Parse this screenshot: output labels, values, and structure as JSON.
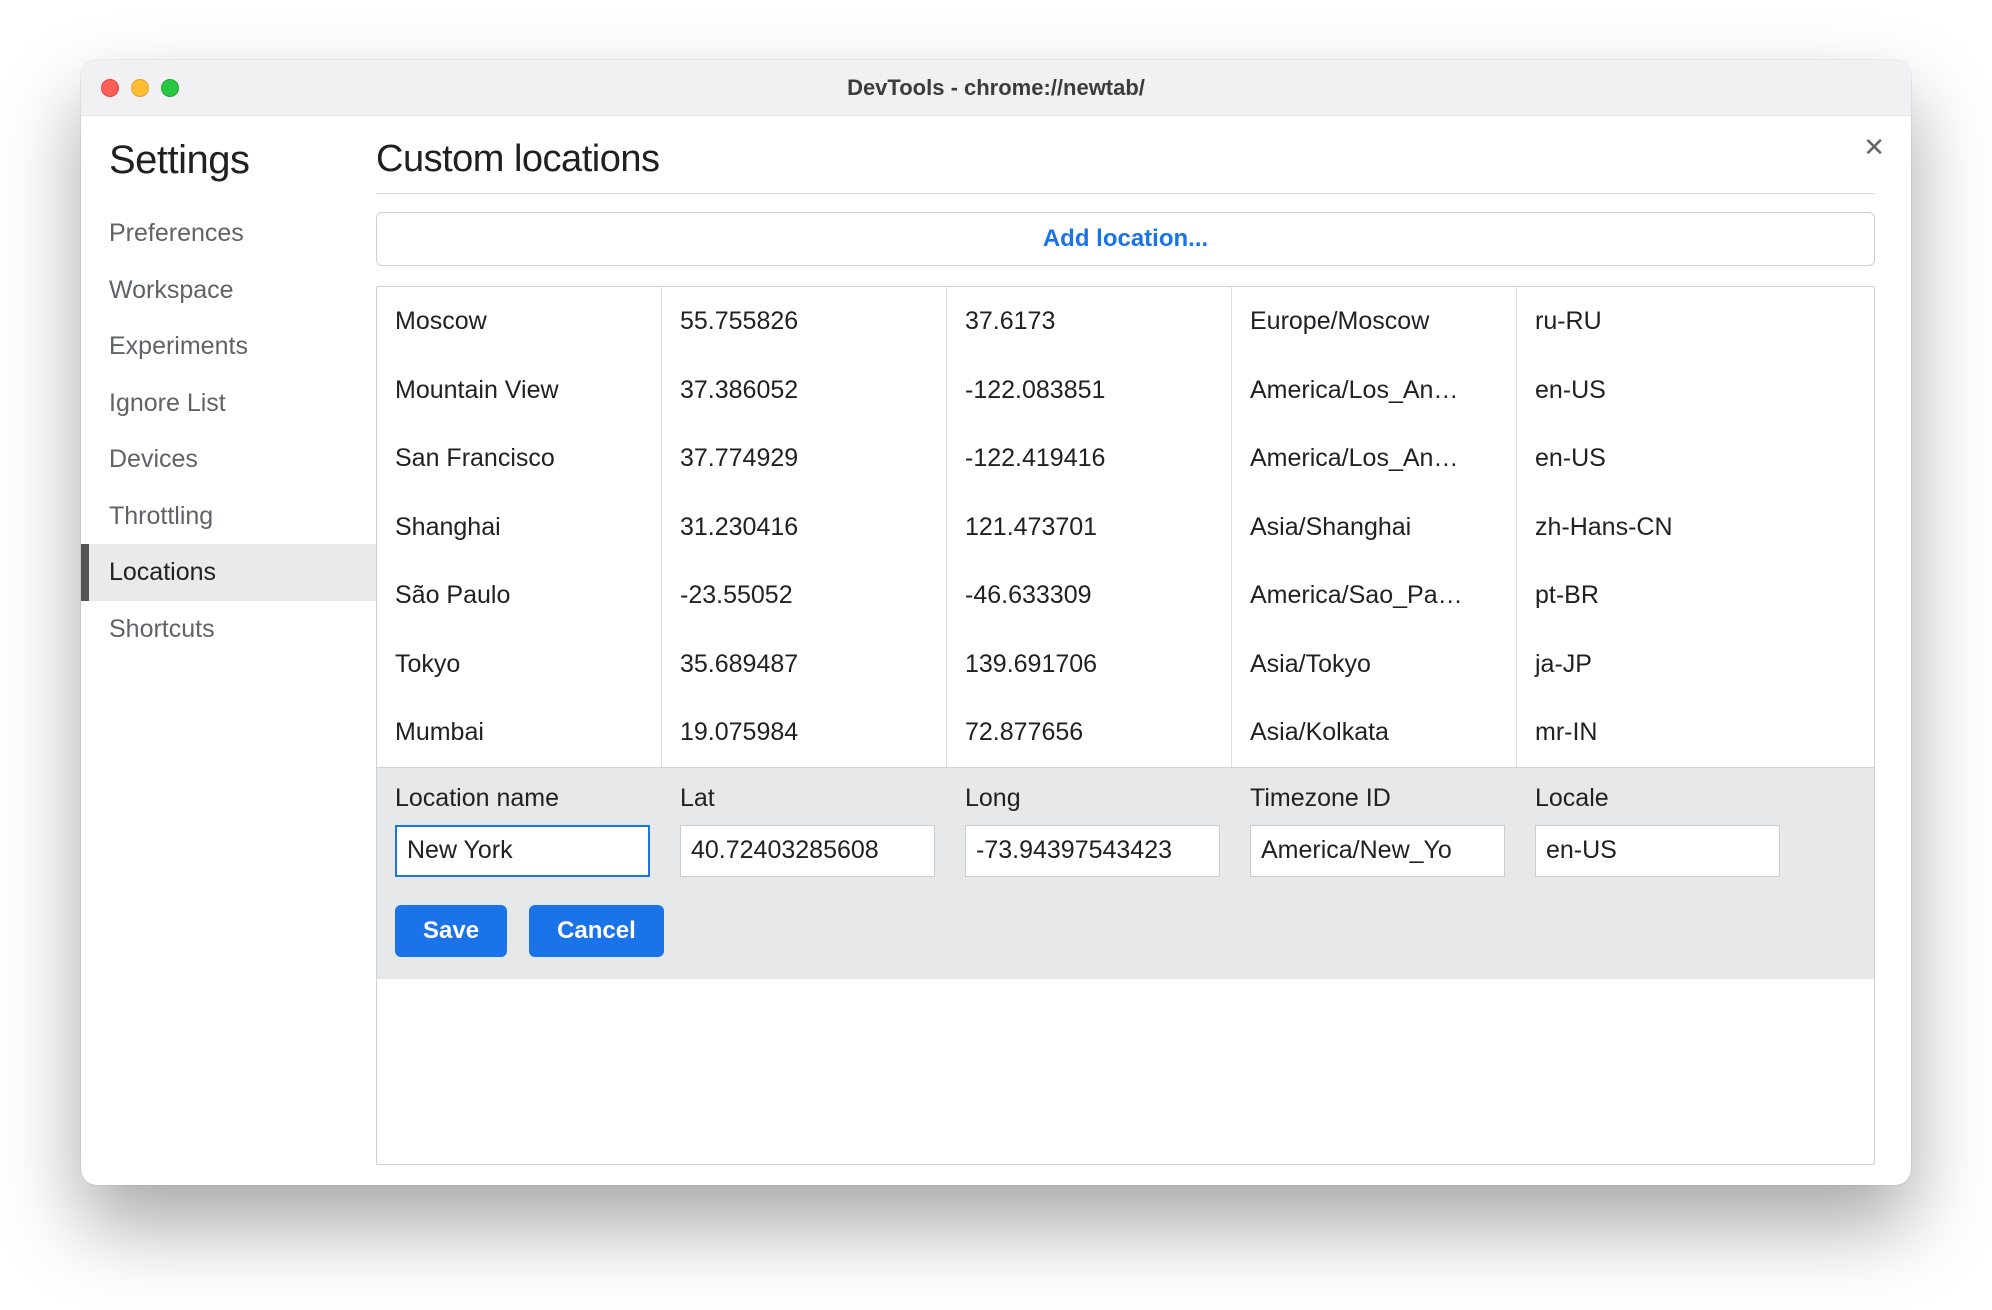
{
  "window": {
    "title": "DevTools - chrome://newtab/"
  },
  "close_glyph": "✕",
  "sidebar": {
    "title": "Settings",
    "items": [
      {
        "label": "Preferences",
        "active": false
      },
      {
        "label": "Workspace",
        "active": false
      },
      {
        "label": "Experiments",
        "active": false
      },
      {
        "label": "Ignore List",
        "active": false
      },
      {
        "label": "Devices",
        "active": false
      },
      {
        "label": "Throttling",
        "active": false
      },
      {
        "label": "Locations",
        "active": true
      },
      {
        "label": "Shortcuts",
        "active": false
      }
    ]
  },
  "main": {
    "title": "Custom locations",
    "add_button": "Add location...",
    "columns": [
      "Location name",
      "Lat",
      "Long",
      "Timezone ID",
      "Locale"
    ],
    "rows": [
      {
        "name": "Moscow",
        "lat": "55.755826",
        "long": "37.6173",
        "tz": "Europe/Moscow",
        "locale": "ru-RU"
      },
      {
        "name": "Mountain View",
        "lat": "37.386052",
        "long": "-122.083851",
        "tz": "America/Los_Angeles",
        "locale": "en-US"
      },
      {
        "name": "San Francisco",
        "lat": "37.774929",
        "long": "-122.419416",
        "tz": "America/Los_Angeles",
        "locale": "en-US"
      },
      {
        "name": "Shanghai",
        "lat": "31.230416",
        "long": "121.473701",
        "tz": "Asia/Shanghai",
        "locale": "zh-Hans-CN"
      },
      {
        "name": "São Paulo",
        "lat": "-23.55052",
        "long": "-46.633309",
        "tz": "America/Sao_Paulo",
        "locale": "pt-BR"
      },
      {
        "name": "Tokyo",
        "lat": "35.689487",
        "long": "139.691706",
        "tz": "Asia/Tokyo",
        "locale": "ja-JP"
      },
      {
        "name": "Mumbai",
        "lat": "19.075984",
        "long": "72.877656",
        "tz": "Asia/Kolkata",
        "locale": "mr-IN"
      }
    ],
    "tz_display": {
      "1": "America/Los_An…",
      "2": "America/Los_An…",
      "4": "America/Sao_Pa…"
    },
    "editor": {
      "labels": {
        "name": "Location name",
        "lat": "Lat",
        "long": "Long",
        "tz": "Timezone ID",
        "locale": "Locale"
      },
      "values": {
        "name": "New York",
        "lat": "40.72403285608",
        "long": "-73.94397543423",
        "tz": "America/New_York",
        "tz_display": "America/New_Yo",
        "locale": "en-US"
      },
      "save": "Save",
      "cancel": "Cancel"
    }
  }
}
